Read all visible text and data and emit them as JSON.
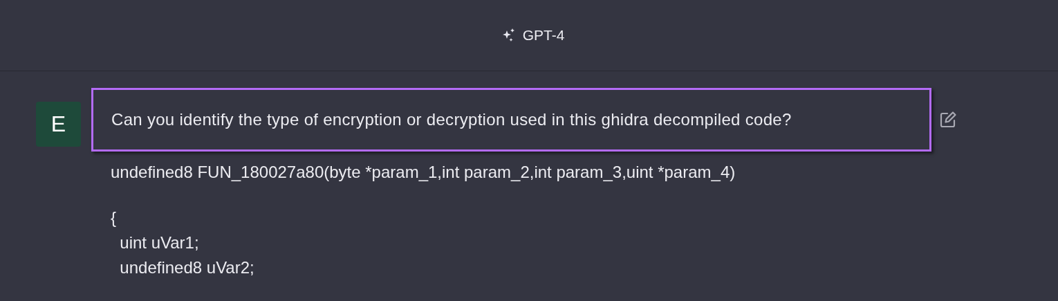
{
  "header": {
    "model": "GPT-4"
  },
  "message": {
    "avatar": "E",
    "highlighted": true,
    "text": "Can you identify the type of encryption or decryption used in this ghidra decompiled code?",
    "code": {
      "signature": "undefined8 FUN_180027a80(byte *param_1,int param_2,int param_3,uint *param_4)",
      "body": [
        "{",
        "  uint uVar1;",
        "  undefined8 uVar2;"
      ]
    }
  }
}
